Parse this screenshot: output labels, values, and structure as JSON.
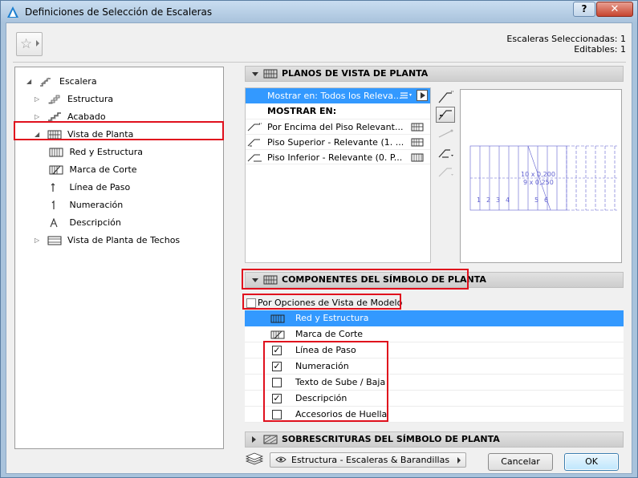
{
  "window": {
    "title": "Definiciones de Selección de Escaleras",
    "help_label": "?",
    "close_label": "✕"
  },
  "selection_info": {
    "line1": "Escaleras Seleccionadas: 1",
    "line2": "Editables: 1"
  },
  "tree": {
    "items": [
      {
        "label": "Escalera",
        "icon": "stair-icon"
      },
      {
        "label": "Estructura",
        "icon": "structure-icon"
      },
      {
        "label": "Acabado",
        "icon": "finish-icon"
      },
      {
        "label": "Vista de Planta",
        "icon": "floor-plan-icon"
      },
      {
        "label": "Red y Estructura",
        "icon": "grid-structure-icon"
      },
      {
        "label": "Marca de Corte",
        "icon": "break-mark-icon"
      },
      {
        "label": "Línea de Paso",
        "icon": "walking-line-icon"
      },
      {
        "label": "Numeración",
        "icon": "numbering-icon"
      },
      {
        "label": "Descripción",
        "icon": "description-icon"
      },
      {
        "label": "Vista de Planta de Techos",
        "icon": "ceiling-plan-icon"
      }
    ]
  },
  "planos": {
    "header": "PLANOS DE VISTA DE PLANTA",
    "rows": [
      {
        "label": "Mostrar en: Todos los Releva..."
      },
      {
        "label": "MOSTRAR EN:"
      },
      {
        "label": "Por Encima del Piso Relevant..."
      },
      {
        "label": "Piso Superior - Relevante (1. ..."
      },
      {
        "label": "Piso Inferior - Relevante (0. P..."
      }
    ],
    "preview_labels": [
      "10 x 0,200",
      "9 x 0,250"
    ],
    "step_numbers": [
      "1",
      "2",
      "3",
      "4",
      "5",
      "6"
    ]
  },
  "componentes": {
    "header": "COMPONENTES DEL SÍMBOLO DE PLANTA",
    "model_option_label": "Por Opciones de Vista de Modelo",
    "rows": [
      {
        "label": "Red y Estructura",
        "checked": null
      },
      {
        "label": "Marca de Corte",
        "checked": null
      },
      {
        "label": "Línea de Paso",
        "checked": true,
        "mark": "✓"
      },
      {
        "label": "Numeración",
        "checked": true,
        "mark": "✓"
      },
      {
        "label": "Texto de Sube / Baja",
        "checked": false,
        "mark": ""
      },
      {
        "label": "Descripción",
        "checked": true,
        "mark": "✓"
      },
      {
        "label": "Accesorios de Huella",
        "checked": false,
        "mark": ""
      }
    ]
  },
  "sobrescrituras": {
    "header": "SOBRESCRITURAS DEL SÍMBOLO DE PLANTA"
  },
  "footer": {
    "layer": "Estructura - Escaleras & Barandillas",
    "cancel_label": "Cancelar",
    "ok_label": "OK"
  },
  "colors": {
    "selection": "#3399ff",
    "highlight": "#e0101d",
    "preview_lines": "#6060d0"
  }
}
